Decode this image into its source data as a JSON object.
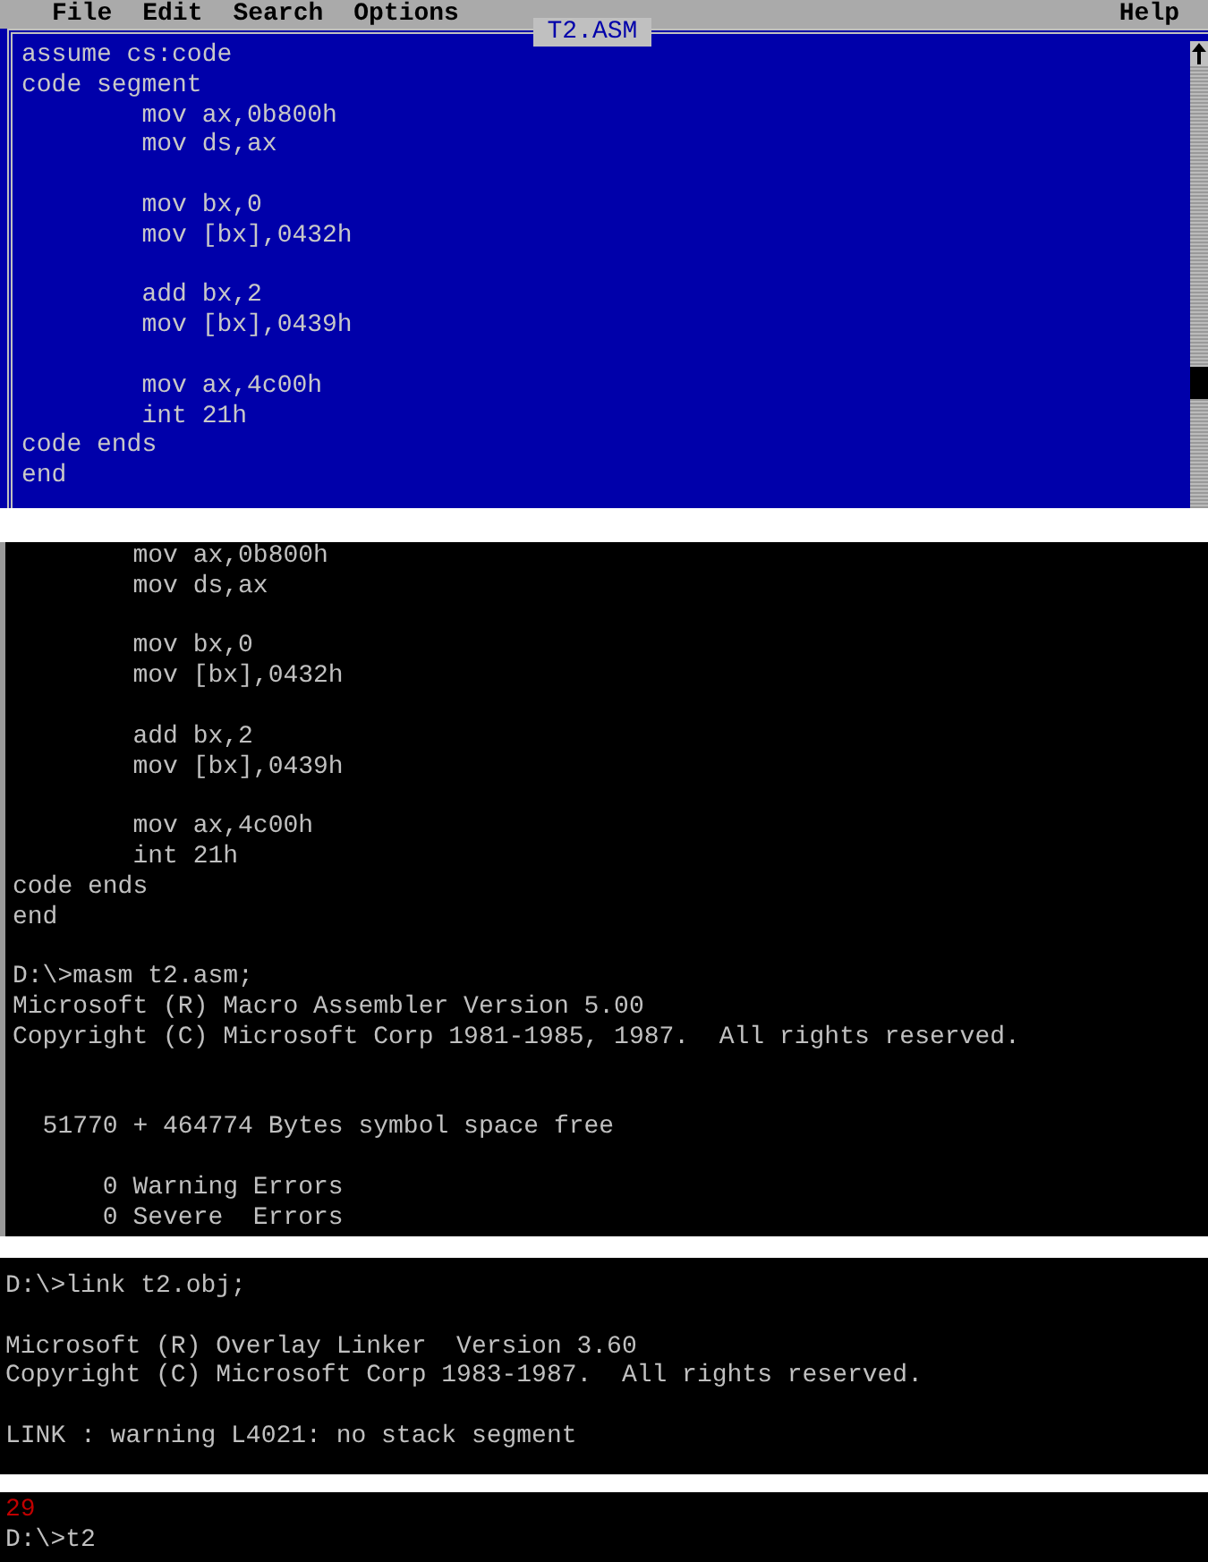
{
  "editor": {
    "menu": [
      "File",
      "Edit",
      "Search",
      "Options"
    ],
    "help_menu": "Help",
    "title": "T2.ASM",
    "lines": [
      {
        "kind": "text",
        "text": "assume cs:code"
      },
      {
        "kind": "text",
        "text": "code segment"
      },
      {
        "kind": "text",
        "text": "        mov ax,0b800h"
      },
      {
        "kind": "text",
        "text": "        mov ds,ax"
      },
      {
        "kind": "blank"
      },
      {
        "kind": "text",
        "text": "        mov bx,0"
      },
      {
        "kind": "text",
        "text": "        mov [bx],0432h"
      },
      {
        "kind": "blank"
      },
      {
        "kind": "text",
        "text": "        add bx,2"
      },
      {
        "kind": "text",
        "text": "        mov [bx],0439h"
      },
      {
        "kind": "blank"
      },
      {
        "kind": "text",
        "text": "        mov ax,4c00h"
      },
      {
        "kind": "text",
        "text": "        int 21h"
      },
      {
        "kind": "text",
        "text": "code ends"
      },
      {
        "kind": "text",
        "text": "end"
      }
    ]
  },
  "consoles": [
    {
      "lines": [
        {
          "kind": "text",
          "text": "        mov ax,0b800h"
        },
        {
          "kind": "text",
          "text": "        mov ds,ax"
        },
        {
          "kind": "blank"
        },
        {
          "kind": "text",
          "text": "        mov bx,0"
        },
        {
          "kind": "text",
          "text": "        mov [bx],0432h"
        },
        {
          "kind": "blank"
        },
        {
          "kind": "text",
          "text": "        add bx,2"
        },
        {
          "kind": "text",
          "text": "        mov [bx],0439h"
        },
        {
          "kind": "blank"
        },
        {
          "kind": "text",
          "text": "        mov ax,4c00h"
        },
        {
          "kind": "text",
          "text": "        int 21h"
        },
        {
          "kind": "text",
          "text": "code ends"
        },
        {
          "kind": "text",
          "text": "end"
        },
        {
          "kind": "blank"
        },
        {
          "kind": "text",
          "text": "D:\\>masm t2.asm;"
        },
        {
          "kind": "text",
          "text": "Microsoft (R) Macro Assembler Version 5.00"
        },
        {
          "kind": "text",
          "text": "Copyright (C) Microsoft Corp 1981-1985, 1987.  All rights reserved."
        },
        {
          "kind": "blank"
        },
        {
          "kind": "blank"
        },
        {
          "kind": "text",
          "text": "  51770 + 464774 Bytes symbol space free"
        },
        {
          "kind": "blank"
        },
        {
          "kind": "text",
          "text": "      0 Warning Errors"
        },
        {
          "kind": "text",
          "text": "      0 Severe  Errors"
        }
      ]
    },
    {
      "lines": [
        {
          "kind": "text",
          "text": "D:\\>link t2.obj;"
        },
        {
          "kind": "blank"
        },
        {
          "kind": "text",
          "text": "Microsoft (R) Overlay Linker  Version 3.60"
        },
        {
          "kind": "text",
          "text": "Copyright (C) Microsoft Corp 1983-1987.  All rights reserved."
        },
        {
          "kind": "blank"
        },
        {
          "kind": "text",
          "text": "LINK : warning L4021: no stack segment"
        }
      ]
    },
    {
      "lines": [
        {
          "kind": "text",
          "text": "29",
          "color": "#c00000"
        },
        {
          "kind": "text",
          "text": "D:\\>t2",
          "color": "#c0c0c0"
        }
      ]
    }
  ]
}
